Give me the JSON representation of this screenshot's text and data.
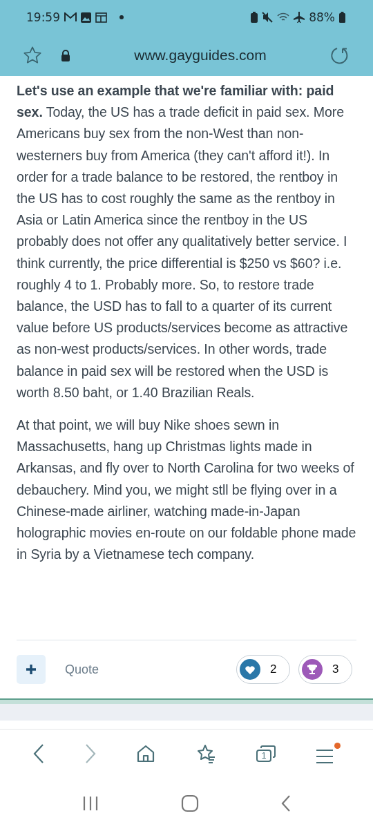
{
  "status_bar": {
    "time": "19:59",
    "battery": "88%"
  },
  "address_bar": {
    "url": "www.gayguides.com"
  },
  "post": {
    "paragraphs": [
      "**Let's use an example that we're familiar with: paid sex.** Today, the US has a trade deficit in paid sex. More Americans buy sex from the non-West than non-westerners buy from America (they can't afford it!). In order for a trade balance to be restored, the rentboy in the US has to cost roughly the same as the rentboy in Asia or Latin America since the rentboy in the US probably does not offer any qualitatively better service. I think currently, the price differential is $250 vs $60? i.e. roughly 4 to 1. Probably more. So, to restore trade balance, the USD has to fall to a quarter of its current value before US products/services become as attractive as non-west products/services. In other words, trade balance in paid sex will be restored when the USD is worth 8.50 baht, or 1.40 Brazilian Reals.",
      "At that point, we will buy Nike shoes sewn in Massachusetts, hang up Christmas lights made in Arkansas, and fly over to North Carolina for two weeks of debauchery. Mind you, we might stll be flying over in a Chinese-made airliner, watching made-in-Japan holographic movies en-route on our foldable phone made in Syria by a Vietnamese tech company."
    ],
    "actions": {
      "quote": "Quote"
    },
    "reactions": [
      {
        "kind": "like",
        "count": "2",
        "color": "#2a77a8"
      },
      {
        "kind": "trophy",
        "count": "3",
        "color": "#9d59b8"
      }
    ]
  },
  "browser_toolbar": {
    "back_disabled": false,
    "forward_disabled": true,
    "tab_count": "1",
    "menu_notification": true
  }
}
